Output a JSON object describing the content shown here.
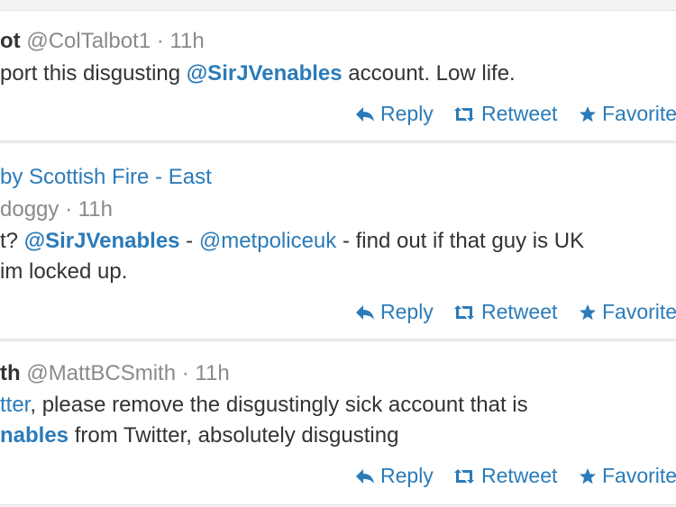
{
  "tweets": [
    {
      "name": "ot",
      "handle": "@ColTalbot1",
      "sep": "·",
      "time": "11h",
      "lines": [
        {
          "a": "port this disgusting ",
          "m": "@SirJVenables",
          "b": " account. Low life."
        }
      ]
    },
    {
      "retweet_by": "by Scottish Fire - East",
      "handle": "doggy",
      "sep": "·",
      "time": "11h",
      "lines": [
        {
          "a": "t? ",
          "m1": "@SirJVenables",
          "d": " - ",
          "m2": "@metpoliceuk",
          "b": " - find out if that guy is UK"
        },
        {
          "a": "im locked up."
        }
      ]
    },
    {
      "name": "th",
      "handle": "@MattBCSmith",
      "sep": "·",
      "time": "11h",
      "lines": [
        {
          "m": "tter",
          "b": ", please remove the disgustingly sick account that is"
        },
        {
          "m": "nables",
          "b": " from Twitter, absolutely disgusting"
        }
      ]
    }
  ],
  "actions": {
    "reply": "Reply",
    "retweet": "Retweet",
    "favorite": "Favorite"
  },
  "colors": {
    "link": "#2b7bb9",
    "meta": "#8a8a8a",
    "text": "#333333"
  }
}
